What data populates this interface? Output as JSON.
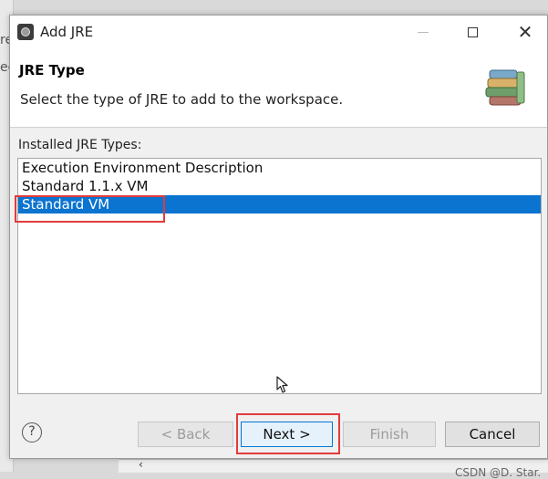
{
  "background": {
    "left_fragments": [
      "re",
      "ec"
    ]
  },
  "window": {
    "title": "Add JRE",
    "icon": "eclipse-app-icon",
    "controls": {
      "minimize_icon": "minimize-icon",
      "maximize_icon": "maximize-icon",
      "close_glyph": "✕"
    }
  },
  "header": {
    "title": "JRE Type",
    "description": "Select the type of JRE to add to the workspace.",
    "art_icon": "books-stack-icon"
  },
  "list": {
    "label": "Installed JRE Types:",
    "items": [
      {
        "label": "Execution Environment Description",
        "selected": false
      },
      {
        "label": "Standard 1.1.x VM",
        "selected": false
      },
      {
        "label": "Standard VM",
        "selected": true
      }
    ]
  },
  "buttons": {
    "help": "?",
    "back": "< Back",
    "next": "Next >",
    "finish": "Finish",
    "cancel": "Cancel"
  },
  "watermark": "CSDN @D. Star.",
  "colors": {
    "selection": "#0a74d0",
    "annotation_red": "#e23b3b",
    "default_button_border": "#0078d7"
  }
}
